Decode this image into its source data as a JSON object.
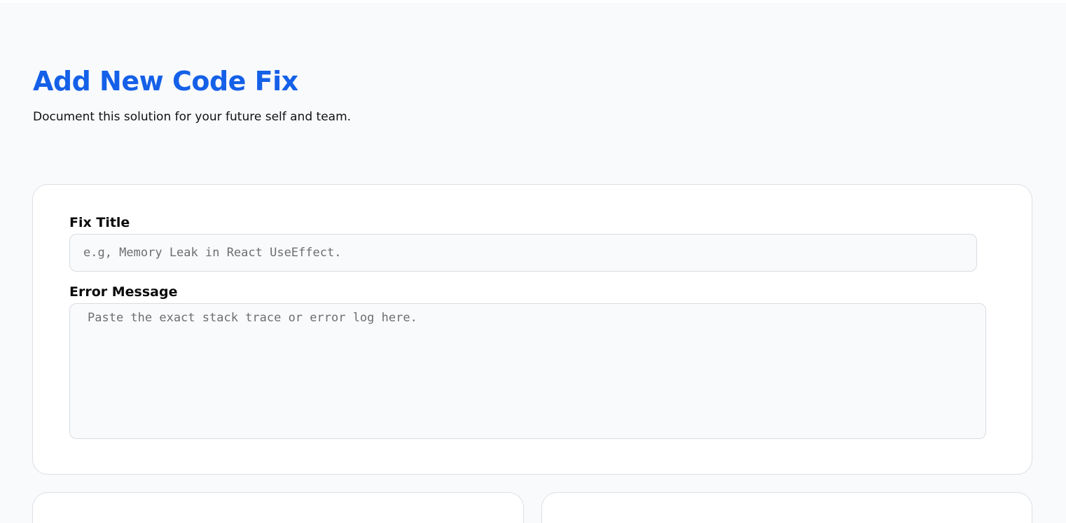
{
  "header": {
    "title": "Add New Code Fix",
    "subtitle": "Document this solution for your future self and team."
  },
  "form": {
    "fix_title": {
      "label": "Fix Title",
      "value": "",
      "placeholder": "e.g, Memory Leak in React UseEffect."
    },
    "error_message": {
      "label": "Error Message",
      "value": "",
      "placeholder": "Paste the exact stack trace or error log here."
    }
  },
  "colors": {
    "accent": "#1560e8",
    "background": "#f8fafc",
    "card": "#ffffff",
    "border": "#dcdfe4"
  }
}
